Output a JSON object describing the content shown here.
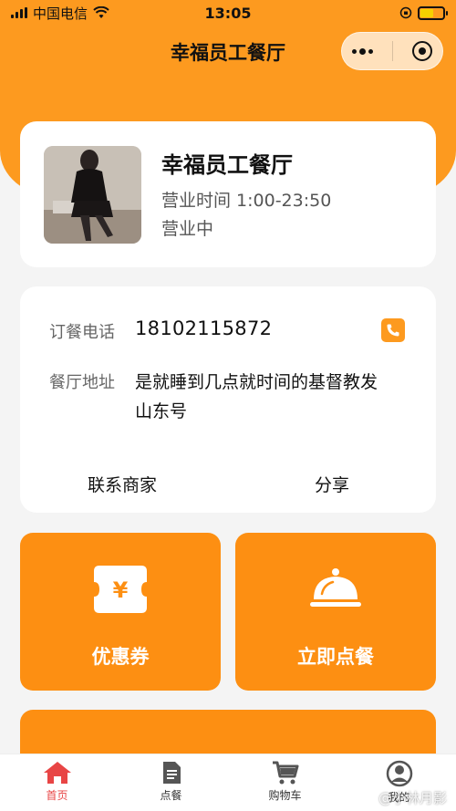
{
  "status_bar": {
    "carrier": "中国电信",
    "time": "13:05"
  },
  "nav": {
    "title": "幸福员工餐厅"
  },
  "store": {
    "name": "幸福员工餐厅",
    "hours": "营业时间 1:00-23:50",
    "status": "营业中"
  },
  "info": {
    "phone_label": "订餐电话",
    "phone_value": "18102115872",
    "address_label": "餐厅地址",
    "address_value": "是就睡到几点就时间的基督教发山东号",
    "contact_label": "联系商家",
    "share_label": "分享"
  },
  "tiles": {
    "coupon_label": "优惠券",
    "order_label": "立即点餐"
  },
  "tabbar": {
    "items": [
      {
        "label": "首页",
        "icon": "home-icon",
        "active": true
      },
      {
        "label": "点餐",
        "icon": "menu-doc-icon",
        "active": false
      },
      {
        "label": "购物车",
        "icon": "cart-icon",
        "active": false
      },
      {
        "label": "我的",
        "icon": "user-icon",
        "active": false
      }
    ]
  },
  "watermark": "@小林月影",
  "colors": {
    "accent": "#fd9a1f",
    "tile": "#fd8f12",
    "active_tab": "#e84545"
  }
}
